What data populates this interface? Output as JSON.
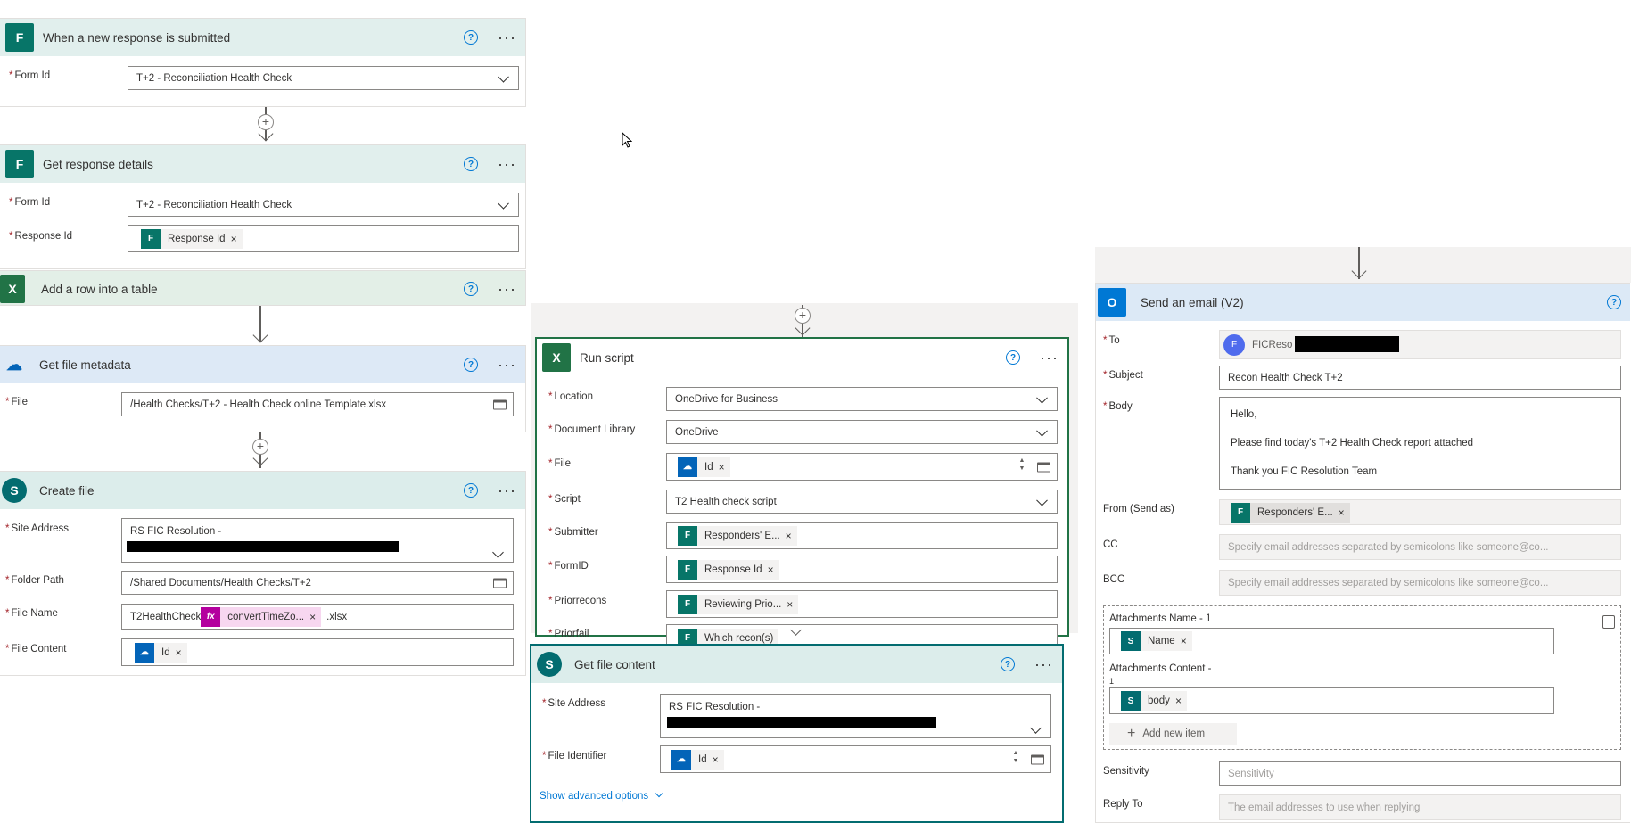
{
  "colors": {
    "forms": "#077568",
    "excel": "#217346",
    "onedrive": "#0364b8",
    "sharepoint": "#036c70",
    "outlook": "#0078d4",
    "expression": "#b4009e"
  },
  "forms_trigger": {
    "title": "When a new response is submitted",
    "form_label": "Form Id",
    "form_value": "T+2 - Reconciliation Health Check"
  },
  "get_response": {
    "title": "Get response details",
    "form_label": "Form Id",
    "form_value": "T+2 - Reconciliation Health Check",
    "response_label": "Response Id",
    "response_token": "Response Id"
  },
  "add_row": {
    "title": "Add a row into a table"
  },
  "file_metadata": {
    "title": "Get file metadata",
    "file_label": "File",
    "file_value": "/Health Checks/T+2 - Health Check online Template.xlsx"
  },
  "create_file": {
    "title": "Create file",
    "site_label": "Site Address",
    "site_value": "RS FIC Resolution -",
    "folder_label": "Folder Path",
    "folder_value": "/Shared Documents/Health Checks/T+2",
    "name_label": "File Name",
    "name_prefix": "T2HealthCheck",
    "name_token": "convertTimeZo...",
    "name_suffix": ".xlsx",
    "content_label": "File Content",
    "content_token": "Id"
  },
  "run_script": {
    "title": "Run script",
    "location_label": "Location",
    "location_value": "OneDrive for Business",
    "library_label": "Document Library",
    "library_value": "OneDrive",
    "file_label": "File",
    "file_token": "Id",
    "script_label": "Script",
    "script_value": "T2 Health check script",
    "submitter_label": "Submitter",
    "submitter_token": "Responders' E...",
    "formid_label": "FormID",
    "formid_token": "Response Id",
    "prior_label": "Priorrecons",
    "prior_token": "Reviewing Prio...",
    "priorfail_label": "Priorfail",
    "priorfail_token": "Which recon(s)"
  },
  "get_file_content": {
    "title": "Get file content",
    "site_label": "Site Address",
    "site_value": "RS FIC Resolution -",
    "id_label": "File Identifier",
    "id_token": "Id",
    "advanced": "Show advanced options"
  },
  "send_email": {
    "title": "Send an email (V2)",
    "to_label": "To",
    "to_initial": "F",
    "to_value": "FICReso",
    "subject_label": "Subject",
    "subject_value": "Recon Health Check T+2",
    "body_label": "Body",
    "body_line1": "Hello,",
    "body_line2": "Please find today's T+2 Health Check report attached",
    "body_line3": "Thank you FIC Resolution Team",
    "from_label": "From (Send as)",
    "from_token": "Responders' E...",
    "cc_label": "CC",
    "cc_placeholder": "Specify email addresses separated by semicolons like someone@co...",
    "bcc_label": "BCC",
    "bcc_placeholder": "Specify email addresses separated by semicolons like someone@co...",
    "att_name_label": "Attachments Name - 1",
    "att_name_token": "Name",
    "att_content_label": "Attachments Content -",
    "att_content_index": "1",
    "att_content_token": "body",
    "add_item": "Add new item",
    "sensitivity_label": "Sensitivity",
    "sensitivity_placeholder": "Sensitivity",
    "reply_label": "Reply To",
    "reply_placeholder": "The email addresses to use when replying"
  }
}
